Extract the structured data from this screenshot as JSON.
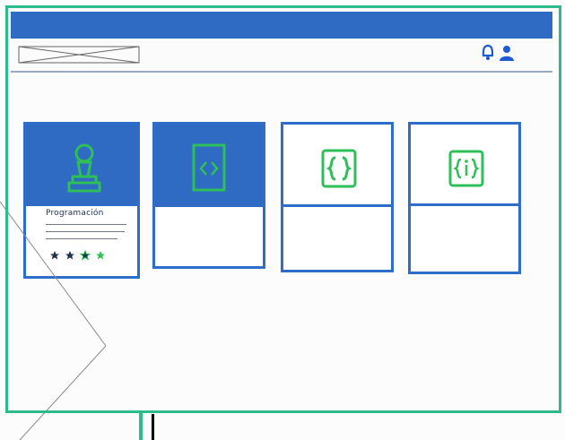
{
  "header": {
    "logo_alt": ""
  },
  "nav": {
    "icons": [
      "bell-icon",
      "user-icon"
    ]
  },
  "cards": [
    {
      "id": "card-1",
      "title": "Programación",
      "icon": "chess-pawn-icon",
      "rating": 4
    },
    {
      "id": "card-2",
      "title": "",
      "icon": "code-file-icon"
    },
    {
      "id": "card-3",
      "title": "",
      "icon": "braces-icon"
    },
    {
      "id": "card-4",
      "title": "",
      "icon": "braces-info-icon"
    }
  ],
  "colors": {
    "accent_blue": "#2f6ac3",
    "green": "#37c35a",
    "frame_green": "#2dbb8c"
  }
}
